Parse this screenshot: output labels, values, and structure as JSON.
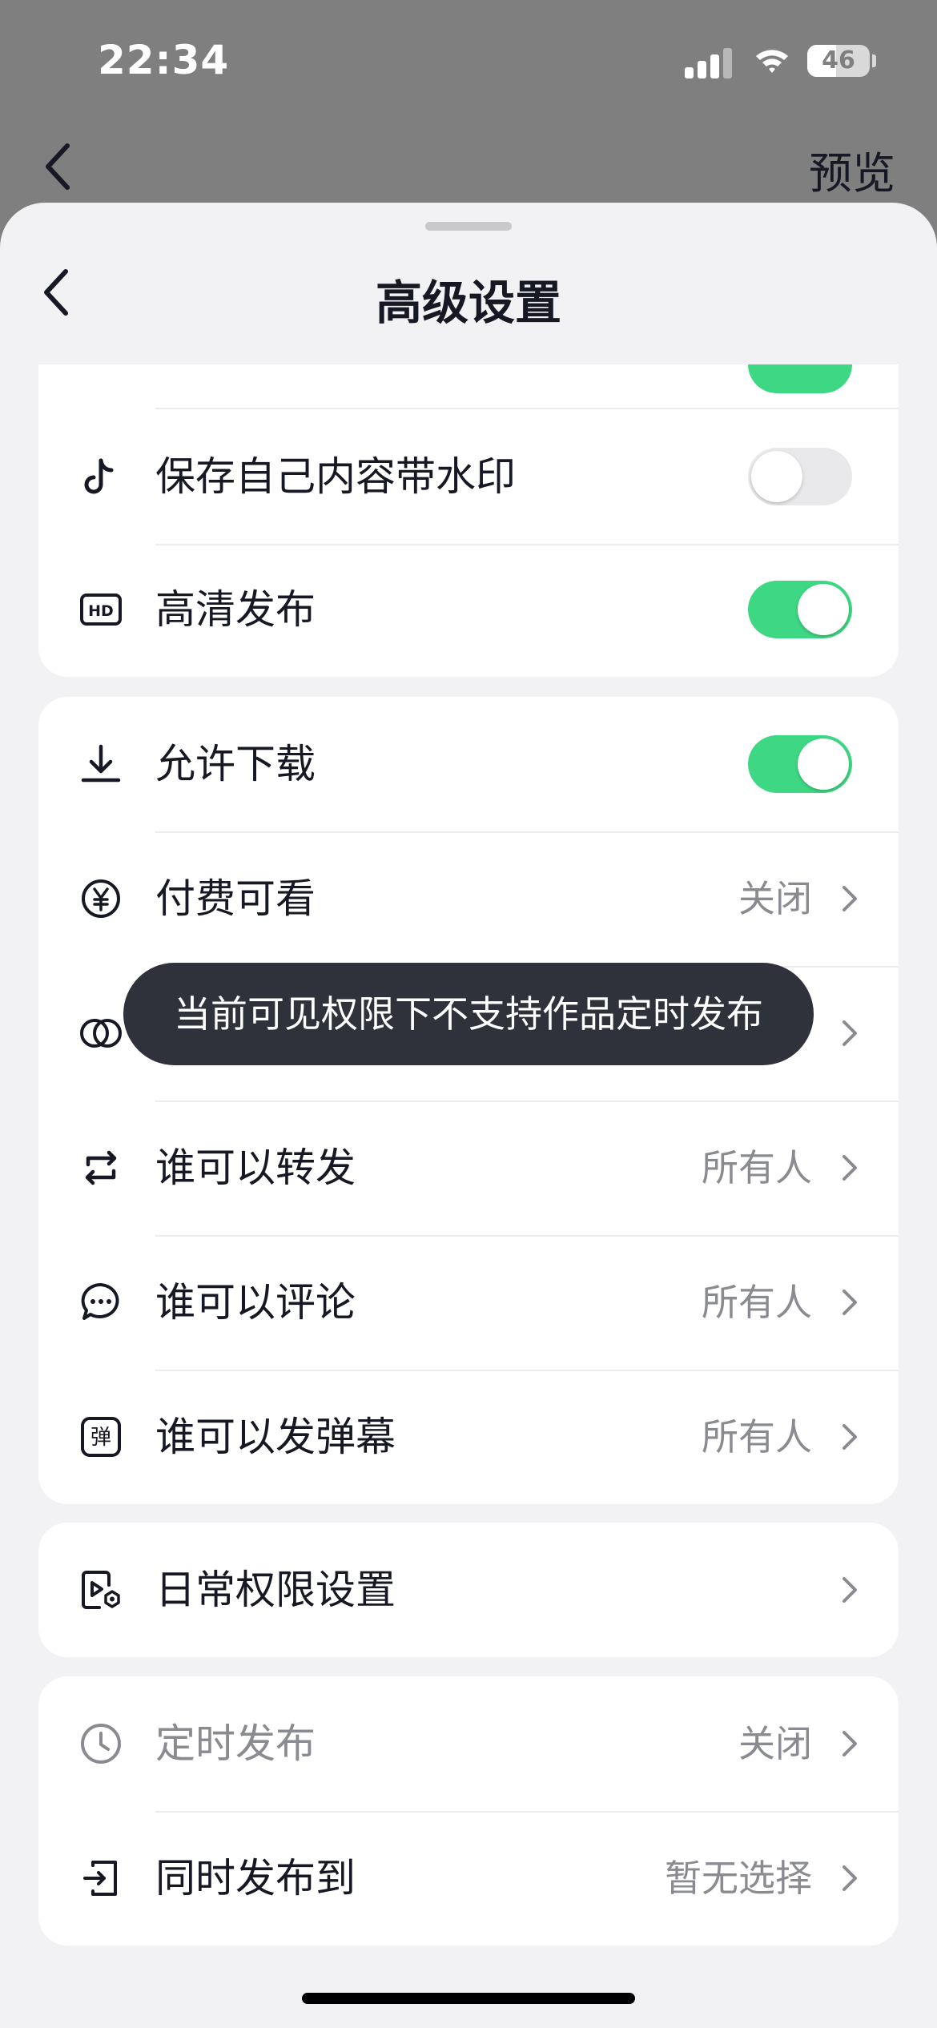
{
  "status_bar": {
    "time": "22:34",
    "battery": "46"
  },
  "background_nav": {
    "preview_label": "预览"
  },
  "sheet": {
    "title": "高级设置"
  },
  "card1": {
    "rows": [
      {
        "label": "保存自己内容带水印",
        "icon": "tiktok-icon",
        "toggle": false
      },
      {
        "label": "高清发布",
        "icon": "hd-icon",
        "toggle": true
      }
    ]
  },
  "card2": {
    "rows": [
      {
        "label": "允许下载",
        "icon": "download-icon",
        "toggle": true
      },
      {
        "label": "付费可看",
        "icon": "yen-icon",
        "value": "关闭"
      },
      {
        "label": "",
        "icon": "circles-icon",
        "value": ""
      },
      {
        "label": "谁可以转发",
        "icon": "repost-icon",
        "value": "所有人"
      },
      {
        "label": "谁可以评论",
        "icon": "comment-icon",
        "value": "所有人"
      },
      {
        "label": "谁可以发弹幕",
        "icon": "danmaku-icon",
        "icon_text": "弹",
        "value": "所有人"
      }
    ]
  },
  "card3": {
    "rows": [
      {
        "label": "日常权限设置",
        "icon": "video-settings-icon"
      }
    ]
  },
  "card4": {
    "rows": [
      {
        "label": "定时发布",
        "icon": "clock-icon",
        "value": "关闭",
        "disabled": true
      },
      {
        "label": "同时发布到",
        "icon": "share-out-icon",
        "value": "暂无选择"
      }
    ]
  },
  "toast": {
    "text": "当前可见权限下不支持作品定时发布"
  },
  "colors": {
    "toggle_on": "#3ed783",
    "toast_bg": "#2f323a",
    "sheet_bg": "#f2f2f4"
  }
}
